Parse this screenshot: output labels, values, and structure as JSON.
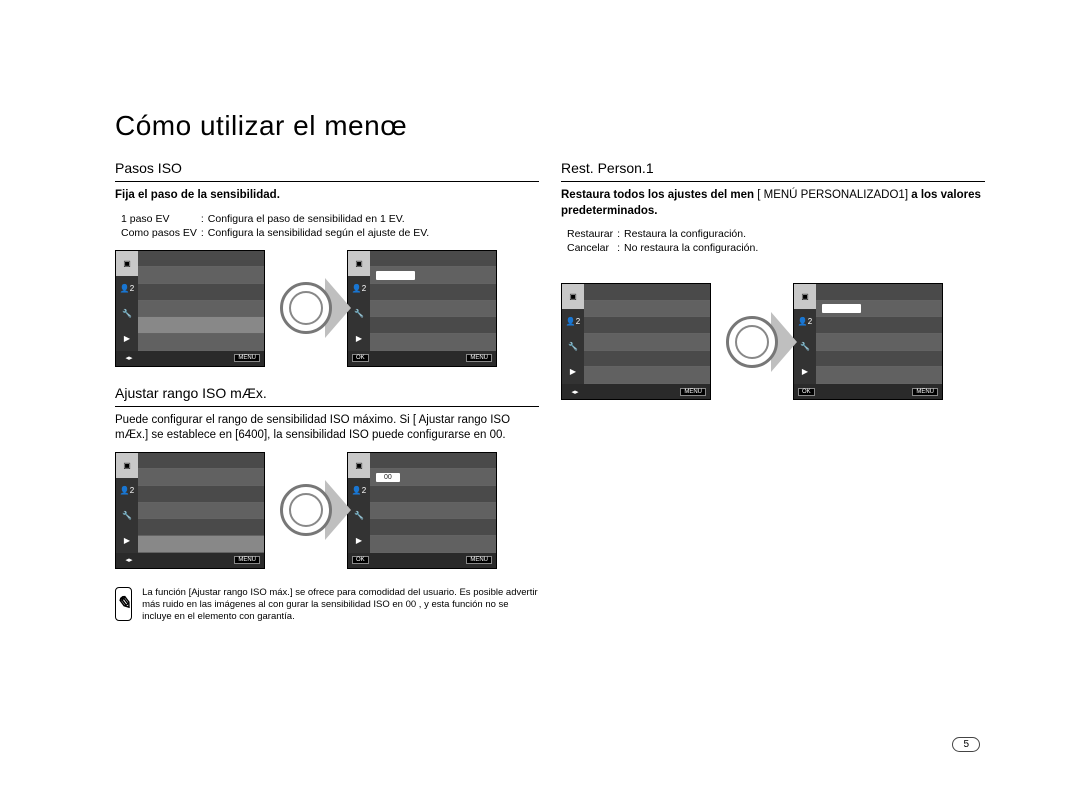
{
  "title": "Cómo utilizar el menœ",
  "page_number": "5",
  "left": {
    "section1": {
      "heading": "Pasos ISO",
      "desc_bold": "Fija el paso de la sensibilidad.",
      "opts": [
        {
          "k": "1 paso EV",
          "sep": ":",
          "v": "Conﬁgura el paso de sensibilidad en 1 EV."
        },
        {
          "k": "Como pasos EV",
          "sep": ":",
          "v": "Conﬁgura la sensibilidad según el ajuste de EV."
        }
      ]
    },
    "section2": {
      "heading": "Ajustar rango ISO mÆx.",
      "desc": "Puede conﬁgurar el rango de sensibilidad ISO máximo. Si [ Ajustar rango ISO mÆx.] se establece en [6400], la sensibilidad ISO puede conﬁgurarse en    00.",
      "popup_value": "00"
    },
    "note": "La función [Ajustar rango ISO máx.] se ofrece para comodidad del usuario. Es posible advertir más ruido en las imágenes al con    gurar la sensibilidad ISO en    00 , y esta función no se incluye en el elemento con garantía."
  },
  "right": {
    "section1": {
      "heading": "Rest. Person.1",
      "desc_prefix": "Restaura todos los ajustes del men",
      "desc_bracket": "[ MENÚ PERSONALIZADO1]",
      "desc_suffix": " a los ",
      "desc_bold2": "valores predeterminados.",
      "opts": [
        {
          "k": "Restaurar",
          "sep": ":",
          "v": "Restaura la conﬁguración."
        },
        {
          "k": "Cancelar",
          "sep": ":",
          "v": "No restaura la conﬁguración."
        }
      ]
    }
  },
  "lcd": {
    "footer_menu": "MENU",
    "footer_ok": "OK",
    "sidebar_person": "2"
  }
}
